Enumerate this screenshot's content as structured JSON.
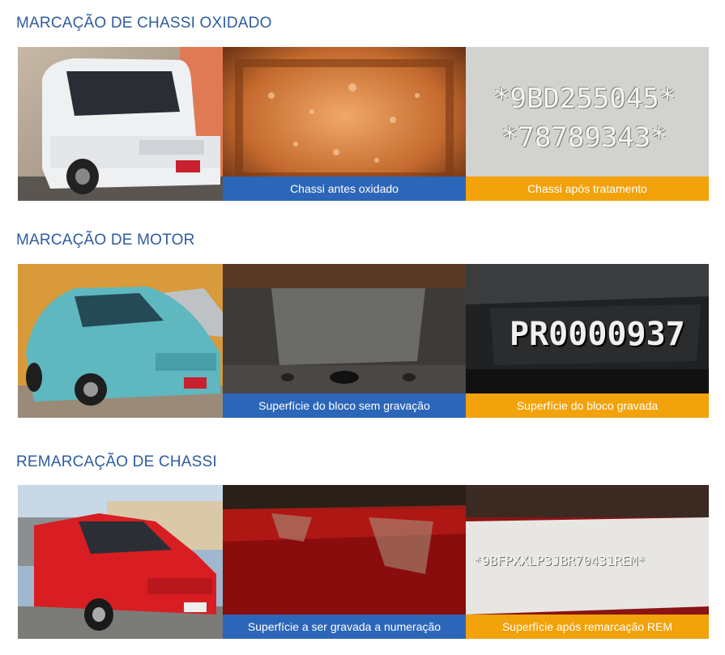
{
  "sections": [
    {
      "title": "MARCAÇÃO DE CHASSI OXIDADO",
      "captions": [
        "Chassi antes oxidado",
        "Chassi após tratamento"
      ],
      "stamp_lines": [
        "*9BD255045*",
        "*78789343*"
      ]
    },
    {
      "title": "MARCAÇÃO DE MOTOR",
      "captions": [
        "Superfície do bloco sem gravação",
        "Superfície do bloco gravada"
      ],
      "stamp_lines": [
        "PR0000937"
      ]
    },
    {
      "title": "REMARCAÇÃO DE CHASSI",
      "captions": [
        "Superfície a ser gravada a numeração",
        "Superfície após remarcação REM"
      ],
      "stamp_lines": [
        "*9BFPXXLP3JBR70431REM*"
      ]
    }
  ],
  "colors": {
    "heading": "#2e5c9e",
    "caption_blue": "#2c66b8",
    "caption_orange": "#f2a20a"
  }
}
